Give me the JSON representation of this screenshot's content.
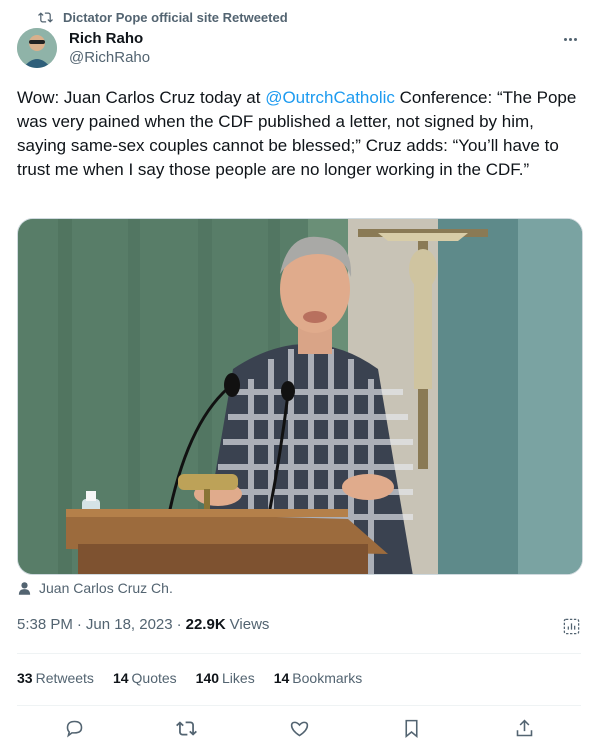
{
  "retweet": {
    "text": "Dictator Pope official site Retweeted",
    "icon": "retweet-icon"
  },
  "author": {
    "name": "Rich Raho",
    "handle": "@RichRaho"
  },
  "tweet": {
    "text_before": "Wow: Juan Carlos Cruz today at ",
    "mention": "@OutrchCatholic",
    "text_after": " Conference: “The Pope was very pained when the CDF published a letter, not signed by him, saying same-sex couples cannot be blessed;” Cruz adds: “You’ll have to trust me when I say those people are no longer working in the CDF.”"
  },
  "tagged_user": "Juan Carlos Cruz Ch.",
  "meta": {
    "time": "5:38 PM",
    "dot": "·",
    "date": "Jun 18, 2023",
    "views_count": "22.9K",
    "views_label": "Views"
  },
  "stats": [
    {
      "count": "33",
      "label": "Retweets"
    },
    {
      "count": "14",
      "label": "Quotes"
    },
    {
      "count": "140",
      "label": "Likes"
    },
    {
      "count": "14",
      "label": "Bookmarks"
    }
  ],
  "colors": {
    "accent": "#1d9bf0",
    "secondary_text": "#536471",
    "primary_text": "#0f1419"
  }
}
